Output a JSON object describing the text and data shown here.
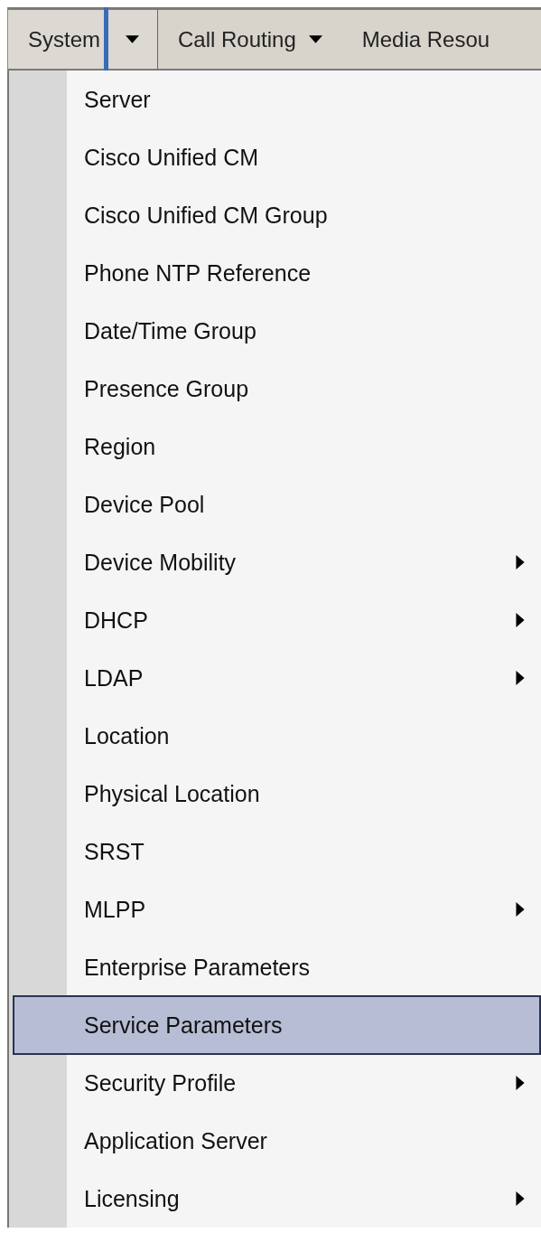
{
  "menubar": [
    {
      "label": "System",
      "dropdown": true,
      "open": true
    },
    {
      "label": "Call Routing",
      "dropdown": true,
      "open": false
    },
    {
      "label": "Media Resou",
      "dropdown": false,
      "open": false
    }
  ],
  "menu": {
    "items": [
      {
        "label": "Server",
        "submenu": false,
        "selected": false
      },
      {
        "label": "Cisco Unified CM",
        "submenu": false,
        "selected": false
      },
      {
        "label": "Cisco Unified CM Group",
        "submenu": false,
        "selected": false
      },
      {
        "label": "Phone NTP Reference",
        "submenu": false,
        "selected": false
      },
      {
        "label": "Date/Time Group",
        "submenu": false,
        "selected": false
      },
      {
        "label": "Presence Group",
        "submenu": false,
        "selected": false
      },
      {
        "label": "Region",
        "submenu": false,
        "selected": false
      },
      {
        "label": "Device Pool",
        "submenu": false,
        "selected": false
      },
      {
        "label": "Device Mobility",
        "submenu": true,
        "selected": false
      },
      {
        "label": "DHCP",
        "submenu": true,
        "selected": false
      },
      {
        "label": "LDAP",
        "submenu": true,
        "selected": false
      },
      {
        "label": "Location",
        "submenu": false,
        "selected": false
      },
      {
        "label": "Physical Location",
        "submenu": false,
        "selected": false
      },
      {
        "label": "SRST",
        "submenu": false,
        "selected": false
      },
      {
        "label": "MLPP",
        "submenu": true,
        "selected": false
      },
      {
        "label": "Enterprise Parameters",
        "submenu": false,
        "selected": false
      },
      {
        "label": "Service Parameters",
        "submenu": false,
        "selected": true
      },
      {
        "label": "Security Profile",
        "submenu": true,
        "selected": false
      },
      {
        "label": "Application Server",
        "submenu": false,
        "selected": false
      },
      {
        "label": "Licensing",
        "submenu": true,
        "selected": false
      }
    ]
  }
}
